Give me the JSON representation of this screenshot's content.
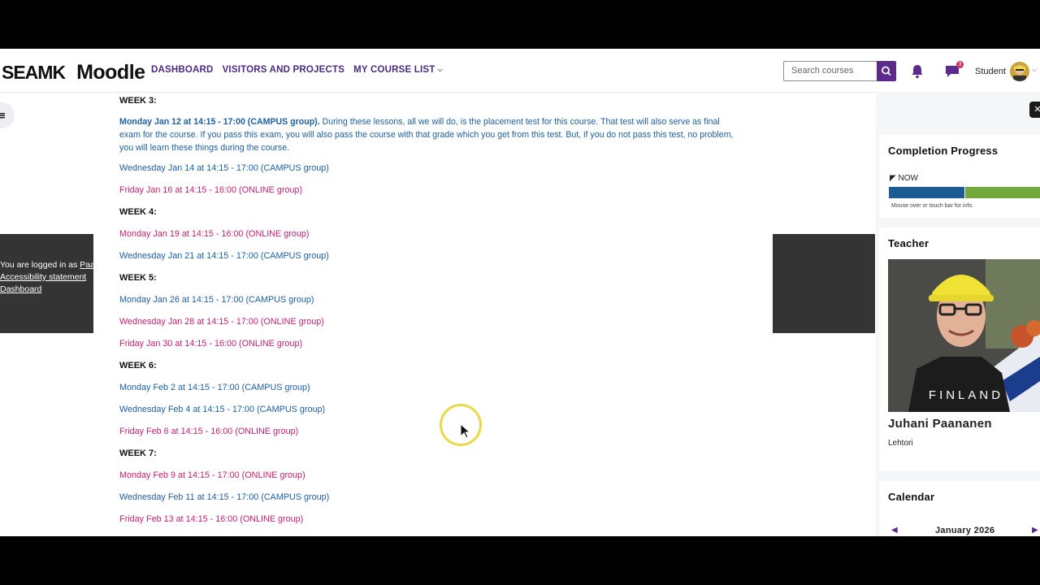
{
  "header": {
    "logo_seamk": "SEAMK",
    "logo_moodle": "Moodle",
    "nav": [
      "DASHBOARD",
      "VISITORS AND PROJECTS",
      "MY COURSE LIST"
    ],
    "search_placeholder": "Search courses",
    "message_count": "3",
    "user_label": "Student"
  },
  "footer_popup": {
    "logged_in_prefix": "You are logged in as ",
    "logged_in_user": "Paa",
    "accessibility": "Accessibility statement",
    "dashboard": "Dashboard"
  },
  "content": {
    "week3": "WEEK 3:",
    "intro_bold": "Monday Jan 12 at 14:15 - 17:00 (CAMPUS group).",
    "intro_text": " During these lessons, all we will do, is the placement test for this course. That test will also serve as final exam for the course. If you pass this exam, you will also pass the course with that grade which you get from this test. But, if you do not pass this test, no problem, you will learn these things during the course.",
    "w3_items": [
      {
        "text": "Wednesday Jan 14 at 14:15 - 17:00 (CAMPUS group)",
        "group": "campus"
      },
      {
        "text": "Friday Jan 16 at 14:15 - 16:00 (ONLINE group)",
        "group": "online"
      }
    ],
    "week4": "WEEK 4:",
    "w4_items": [
      {
        "text": "Monday Jan 19 at 14:15 - 16:00 (ONLINE group)",
        "group": "online"
      },
      {
        "text": "Wednesday Jan 21 at 14:15 - 17:00 (CAMPUS group)",
        "group": "campus"
      }
    ],
    "week5": "WEEK 5:",
    "w5_items": [
      {
        "text": "Monday Jan 26 at 14:15 - 17:00 (CAMPUS group)",
        "group": "campus"
      },
      {
        "text": "Wednesday Jan 28 at 14:15 - 17:00 (ONLINE group)",
        "group": "online"
      },
      {
        "text": "Friday Jan 30 at 14:15 - 16:00 (ONLINE group)",
        "group": "online"
      }
    ],
    "week6": "WEEK 6:",
    "w6_items": [
      {
        "text": "Monday Feb 2 at 14:15 - 17:00 (CAMPUS group)",
        "group": "campus"
      },
      {
        "text": "Wednesday Feb 4 at 14:15 - 17:00 (CAMPUS group)",
        "group": "campus"
      },
      {
        "text": "Friday Feb 6 at 14:15 - 16:00 (ONLINE group)",
        "group": "online"
      }
    ],
    "week7": "WEEK 7:",
    "w7_items": [
      {
        "text": "Monday Feb 9 at 14:15 - 17:00 (ONLINE group)",
        "group": "online"
      },
      {
        "text": "Wednesday Feb 11 at 14:15 - 17:00 (CAMPUS group)",
        "group": "campus"
      },
      {
        "text": "Friday Feb 13 at 14:15 - 16:00 (ONLINE group)",
        "group": "online"
      }
    ]
  },
  "sidebar": {
    "completion_title": "Completion Progress",
    "now_label": "NOW",
    "completion_hint": "Mouse over or touch bar for info.",
    "teacher_title": "Teacher",
    "photo_caption": "FINLAND",
    "teacher_name": "Juhani Paananen",
    "teacher_role": "Lehtori",
    "calendar_title": "Calendar",
    "calendar_month": "January 2026"
  },
  "colors": {
    "brand": "#5b2a8c",
    "campus": "#1d5fa0",
    "online": "#c4216f",
    "progress_done": "#1d5a94",
    "progress_todo": "#72a83c"
  }
}
